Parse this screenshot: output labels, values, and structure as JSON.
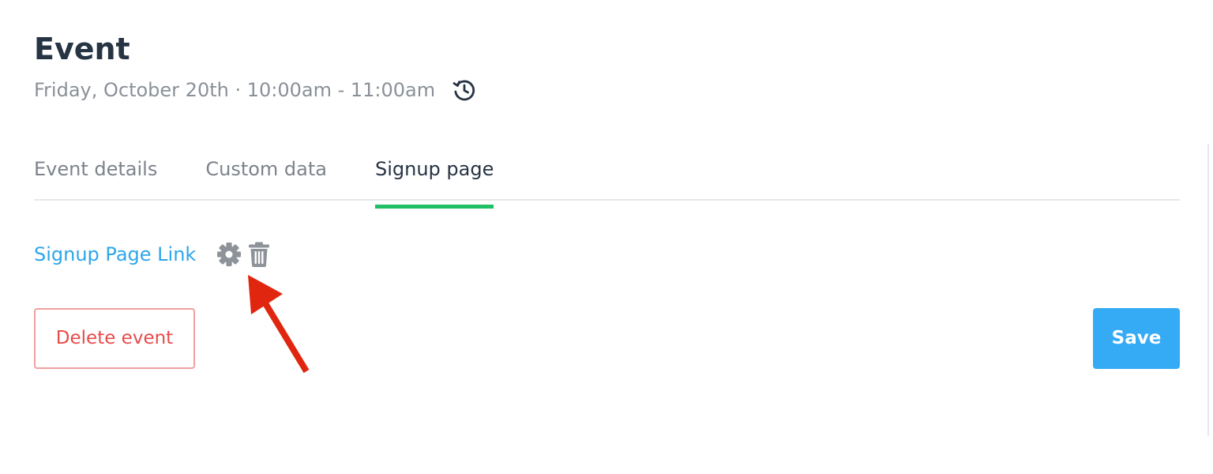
{
  "header": {
    "title": "Event",
    "subtitle": "Friday, October 20th · 10:00am - 11:00am",
    "history_icon": "clock-history-icon"
  },
  "tabs": [
    {
      "label": "Event details",
      "active": false
    },
    {
      "label": "Custom data",
      "active": false
    },
    {
      "label": "Signup page",
      "active": true
    }
  ],
  "signup": {
    "link_label": "Signup Page Link",
    "settings_icon": "gear-icon",
    "delete_icon": "trash-icon"
  },
  "actions": {
    "delete_label": "Delete event",
    "save_label": "Save"
  },
  "annotation": {
    "type": "arrow",
    "points_to": "gear-icon",
    "color": "#e0260f"
  },
  "colors": {
    "title": "#273444",
    "muted": "#8a9098",
    "active_tab_underline": "#21bf66",
    "link": "#2da6e8",
    "danger": "#e84a4a",
    "primary": "#35aaf5"
  }
}
